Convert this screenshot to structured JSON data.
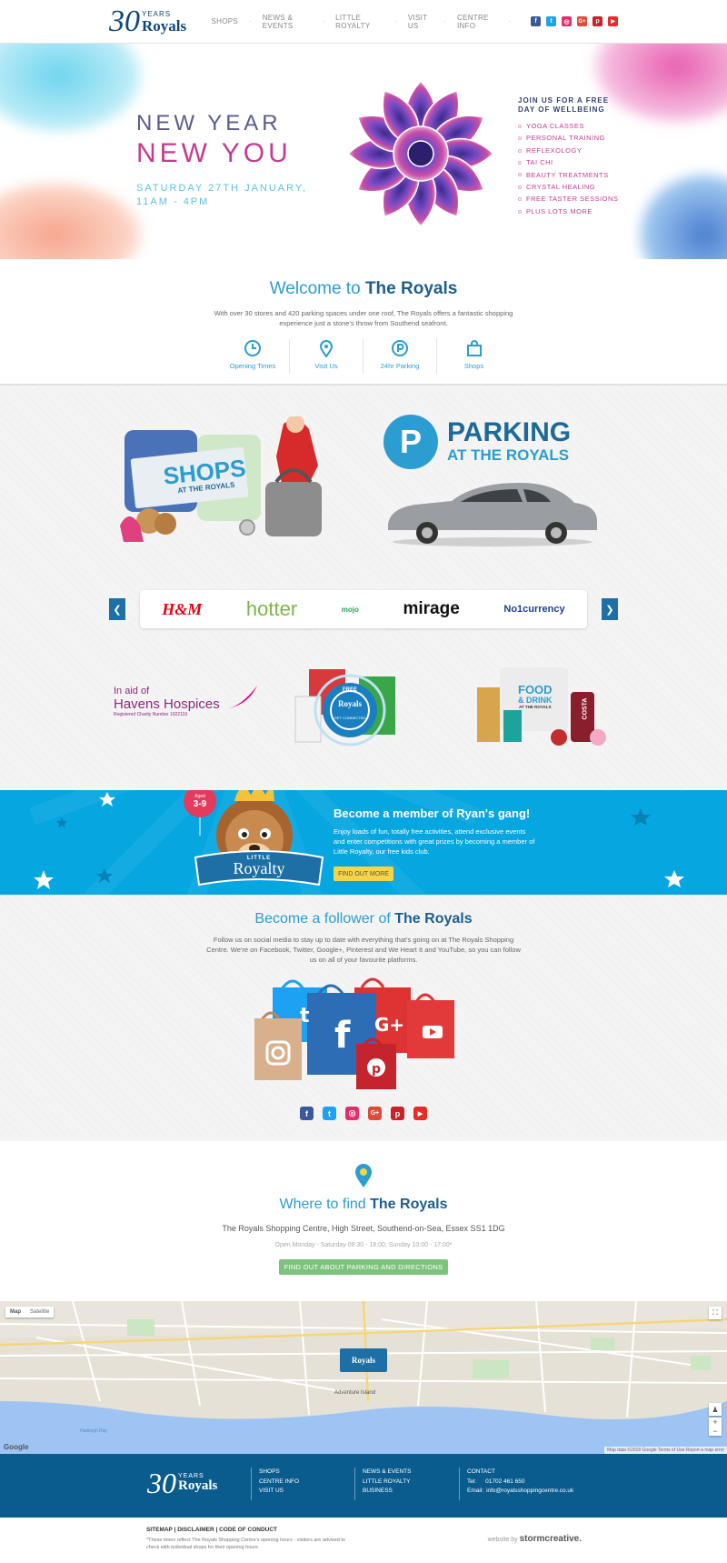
{
  "logo": {
    "number": "30",
    "years": "YEARS",
    "name": "Royals"
  },
  "nav": [
    "SHOPS",
    "NEWS & EVENTS",
    "LITTLE ROYALTY",
    "VISIT US",
    "CENTRE INFO"
  ],
  "social_icons": [
    {
      "icon": "facebook-icon",
      "glyph": "f",
      "color": "#3b5998"
    },
    {
      "icon": "twitter-icon",
      "glyph": "t",
      "color": "#1da1f2"
    },
    {
      "icon": "instagram-icon",
      "glyph": "◎",
      "color": "#e1306c"
    },
    {
      "icon": "google-plus-icon",
      "glyph": "G+",
      "color": "#dd4b39"
    },
    {
      "icon": "pinterest-icon",
      "glyph": "p",
      "color": "#cb2027"
    },
    {
      "icon": "youtube-icon",
      "glyph": "▶",
      "color": "#e52d27"
    }
  ],
  "hero": {
    "line1": "NEW YEAR",
    "line2": "NEW YOU",
    "date": "SATURDAY 27TH JANUARY, 11AM - 4PM",
    "right_title": "JOIN US FOR A FREE DAY OF WELLBEING",
    "items": [
      "YOGA CLASSES",
      "PERSONAL TRAINING",
      "REFLEXOLOGY",
      "TAI CHI",
      "BEAUTY TREATMENTS",
      "CRYSTAL HEALING",
      "FREE TASTER SESSIONS",
      "PLUS LOTS MORE"
    ]
  },
  "welcome": {
    "title_pre": "Welcome to ",
    "title_bold": "The Royals",
    "text": "With over 30 stores and 420 parking spaces under one roof, The Royals offers a fantastic shopping experience just a stone's throw from Southend seafront.",
    "links": [
      {
        "label": "Opening Times",
        "icon": "clock-icon"
      },
      {
        "label": "Visit Us",
        "icon": "map-pin-icon"
      },
      {
        "label": "24hr Parking",
        "icon": "parking-icon"
      },
      {
        "label": "Shops",
        "icon": "shopping-bag-icon"
      }
    ]
  },
  "promo": {
    "shops_tag_big": "SHOPS",
    "shops_tag_small": "AT THE ROYALS",
    "parking_letter": "P",
    "parking_title": "PARKING",
    "parking_sub": "AT THE ROYALS",
    "brands": [
      {
        "name": "H&M",
        "color": "#e50010"
      },
      {
        "name": "hotter",
        "color": "#7ab648"
      },
      {
        "name": "mojo",
        "color": "#2aa35a"
      },
      {
        "name": "mirage",
        "color": "#111111"
      },
      {
        "name": "No1currency",
        "color": "#1c3f94"
      }
    ],
    "havens_1": "In aid of",
    "havens_2": "Havens Hospices",
    "havens_3": "Registered Charity Number 1022119",
    "wifi_1": "FREE",
    "wifi_2": "Royals",
    "wifi_3": "GET CONNECTED",
    "food_1": "FOOD",
    "food_2": "& DRINK",
    "food_3": "AT THE ROYALS",
    "costa": "COSTA"
  },
  "royalty": {
    "badge_small": "Aged",
    "badge_big": "3-9",
    "banner_small": "LITTLE",
    "banner_big": "Royalty",
    "title": "Become a member of Ryan's gang!",
    "text": "Enjoy loads of fun, totally free activities, attend exclusive events and enter competitions with great prizes by becoming a member of Little Royalty, our free kids club.",
    "button": "FIND OUT MORE"
  },
  "follow": {
    "title_pre": "Become a follower of ",
    "title_bold": "The Royals",
    "text": "Follow us on social media to stay up to date with everything that's going on at The Royals Shopping Centre. We're on Facebook, Twitter, Google+, Pinterest and We Heart It and YouTube, so you can follow us on all of your favourite platforms."
  },
  "find": {
    "title_pre": "Where to find ",
    "title_bold": "The Royals",
    "address": "The Royals Shopping Centre, High Street, Southend-on-Sea, Essex SS1 1DG",
    "hours": "Open Monday - Saturday 08:30 - 18:00, Sunday 10:00 - 17:00*",
    "button": "FIND OUT ABOUT PARKING AND DIRECTIONS"
  },
  "map": {
    "type_map": "Map",
    "type_sat": "Satellite",
    "label": "Adventure Island",
    "water_label": "Hadleigh Ray",
    "google": "Google",
    "attribution": "Map data ©2018 Google   Terms of Use   Report a map error",
    "marker": "Royals"
  },
  "footer": {
    "col1": [
      "SHOPS",
      "CENTRE INFO",
      "VISIT US"
    ],
    "col2": [
      "NEWS & EVENTS",
      "LITTLE ROYALTY",
      "BUSINESS"
    ],
    "contact_title": "CONTACT",
    "tel_label": "Tel:",
    "tel": "01702 461 650",
    "email_label": "Email:",
    "email": "info@royalsshoppingcentre.co.uk"
  },
  "subfooter": {
    "links": "SITEMAP | DISCLAIMER | CODE OF CONDUCT",
    "note": "*These times reflect The Royals Shopping Centre's opening hours - visitors are advised to check with individual shops for their opening hours",
    "credit_pre": "website by ",
    "credit_brand": "stormcreative."
  },
  "colors": {
    "brand_blue": "#2b9dd1",
    "navy": "#0b5c8e",
    "pink": "#c63b8f",
    "kids_blue": "#06a6e1",
    "button_green": "#7dc37d"
  }
}
